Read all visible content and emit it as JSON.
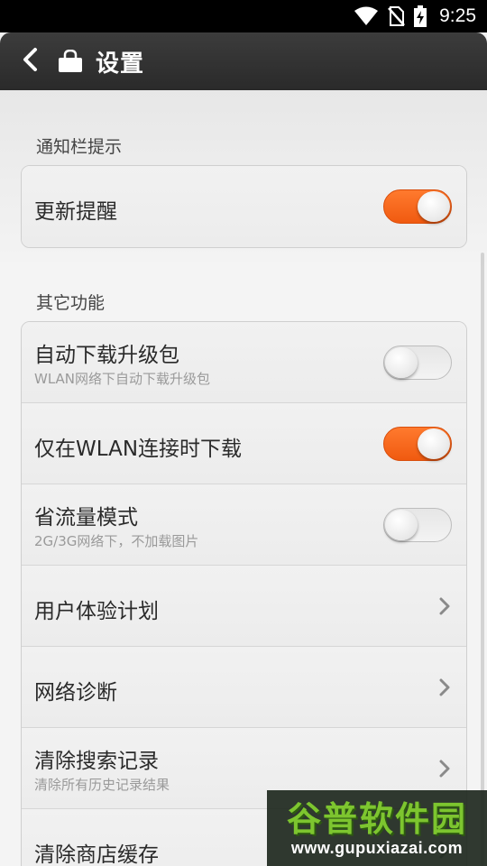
{
  "status_bar": {
    "time": "9:25",
    "icons": [
      "wifi-icon",
      "no-sim-icon",
      "battery-charging-icon"
    ]
  },
  "header": {
    "title": "设置",
    "back_icon": "chevron-left-icon",
    "app_icon": "store-bag-icon"
  },
  "sections": [
    {
      "header": "通知栏提示",
      "items": [
        {
          "label": "更新提醒",
          "type": "toggle",
          "enabled": true
        }
      ]
    },
    {
      "header": "其它功能",
      "items": [
        {
          "label": "自动下载升级包",
          "sub": "WLAN网络下自动下载升级包",
          "type": "toggle",
          "enabled": false
        },
        {
          "label": "仅在WLAN连接时下载",
          "type": "toggle",
          "enabled": true
        },
        {
          "label": "省流量模式",
          "sub": "2G/3G网络下，不加载图片",
          "type": "toggle",
          "enabled": false
        },
        {
          "label": "用户体验计划",
          "type": "link"
        },
        {
          "label": "网络诊断",
          "type": "link"
        },
        {
          "label": "清除搜索记录",
          "sub": "清除所有历史记录结果",
          "type": "link"
        },
        {
          "label": "清除商店缓存",
          "type": "link"
        }
      ]
    }
  ],
  "watermark": {
    "title": "谷普软件园",
    "url": "www.gupuxiazai.com"
  },
  "colors": {
    "accent": "#f26418",
    "title_bar": "#333333",
    "background": "#f2f2f2"
  }
}
